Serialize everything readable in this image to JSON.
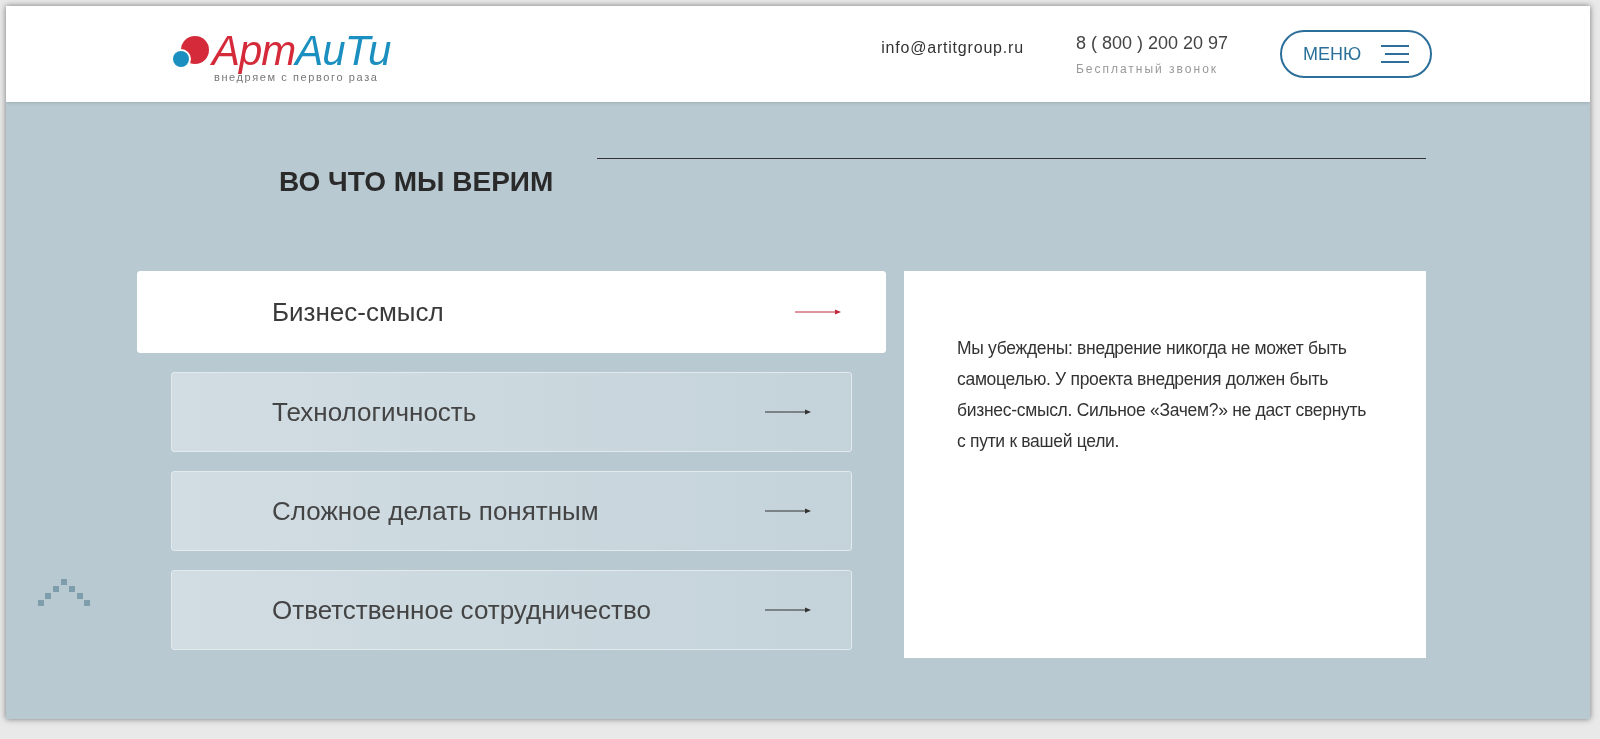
{
  "header": {
    "logo": {
      "part_1": "Арт",
      "part_2": "АиТи",
      "tagline": "внедряем с первого раза"
    },
    "email": "info@artitgroup.ru",
    "phone": {
      "number": "8 ( 800 ) 200 20 97",
      "caption": "Бесплатный звонок"
    },
    "menu_button": "МЕНЮ"
  },
  "section": {
    "title": "ВО ЧТО МЫ ВЕРИМ",
    "items": [
      {
        "label": "Бизнес-смысл",
        "selected": true
      },
      {
        "label": "Технологичность",
        "selected": false
      },
      {
        "label": "Сложное делать понятным",
        "selected": false
      },
      {
        "label": "Ответственное сотрудничество",
        "selected": false
      }
    ],
    "description": "Мы убеждены: внедрение никогда не может быть самоцелью. У проекта внедрения должен быть бизнес-смысл. Сильное «Зачем?» не даст свернуть с пути к вашей цели."
  }
}
